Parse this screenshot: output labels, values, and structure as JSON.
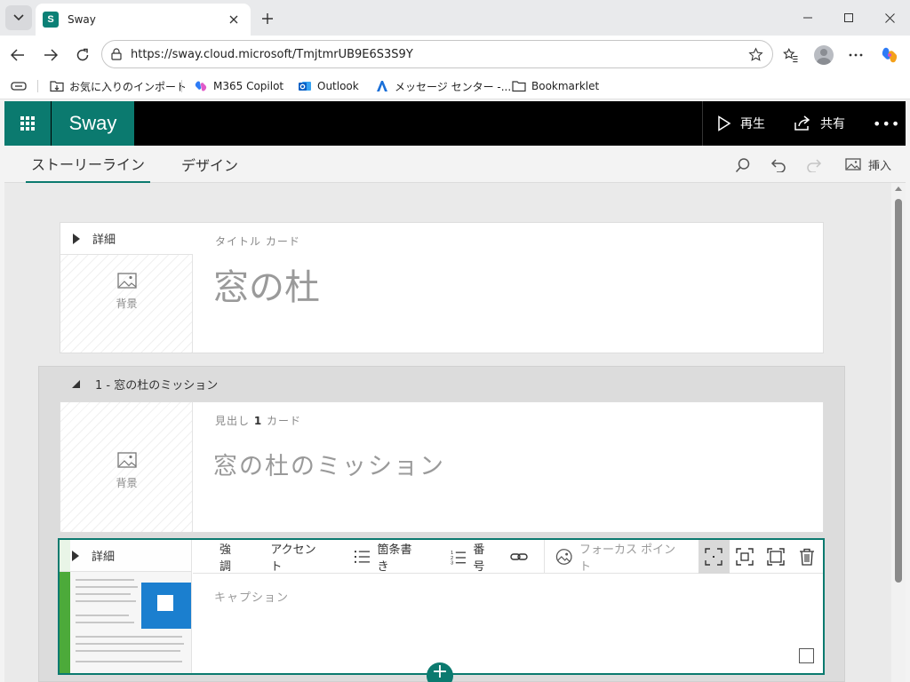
{
  "browser": {
    "tab_title": "Sway",
    "tab_favicon": "S",
    "url": "https://sway.cloud.microsoft/TmjtmrUB9E6S3S9Y",
    "bookmarks": [
      {
        "label": "お気に入りのインポート",
        "icon": "folder-import-icon"
      },
      {
        "label": "M365 Copilot",
        "icon": "copilot-icon"
      },
      {
        "label": "Outlook",
        "icon": "outlook-icon"
      },
      {
        "label": "メッセージ センター -...",
        "icon": "message-center-icon"
      },
      {
        "label": "Bookmarklet",
        "icon": "folder-icon"
      }
    ]
  },
  "app": {
    "brand": "Sway",
    "play_label": "再生",
    "share_label": "共有",
    "more_label": "•••"
  },
  "tabs": {
    "storyline": "ストーリーライン",
    "design": "デザイン",
    "insert": "挿入"
  },
  "title_card": {
    "detail": "詳細",
    "background": "背景",
    "label": "タイトル カード",
    "title": "窓の杜"
  },
  "section": {
    "heading": "1 - 窓の杜のミッション"
  },
  "heading_card": {
    "background": "背景",
    "label_prefix": "見出し",
    "label_level": "1",
    "label_suffix": "カード",
    "title": "窓の杜のミッション"
  },
  "image_card": {
    "detail": "詳細",
    "toolbar": {
      "emphasis": "強調",
      "accent": "アクセント",
      "bullets": "箇条書き",
      "numbering": "番号",
      "focus_point": "フォーカス ポイント"
    },
    "caption_placeholder": "キャプション"
  },
  "colors": {
    "accent": "#0b7a6f",
    "app_bar": "#000000"
  }
}
